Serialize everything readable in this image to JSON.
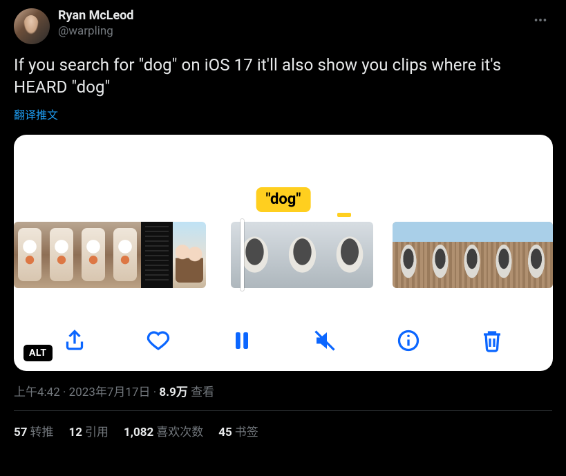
{
  "author": {
    "display_name": "Ryan McLeod",
    "handle": "@warpling"
  },
  "body_text": "If you search for \"dog\" on iOS 17 it'll also show you clips where it's HEARD \"dog\"",
  "translate_label": "翻译推文",
  "media": {
    "tooltip_text": "\"dog\"",
    "alt_badge": "ALT",
    "toolbar": {
      "share": "share",
      "like": "like",
      "pause": "pause",
      "mute": "mute",
      "info": "info",
      "delete": "delete"
    }
  },
  "meta": {
    "time": "上午4:42",
    "dot1": " · ",
    "date": "2023年7月17日",
    "dot2": " · ",
    "views_number": "8.9万",
    "views_label": " 查看"
  },
  "stats": {
    "retweets_num": "57",
    "retweets_label": "转推",
    "quotes_num": "12",
    "quotes_label": "引用",
    "likes_num": "1,082",
    "likes_label": "喜欢次数",
    "bookmarks_num": "45",
    "bookmarks_label": "书签"
  }
}
